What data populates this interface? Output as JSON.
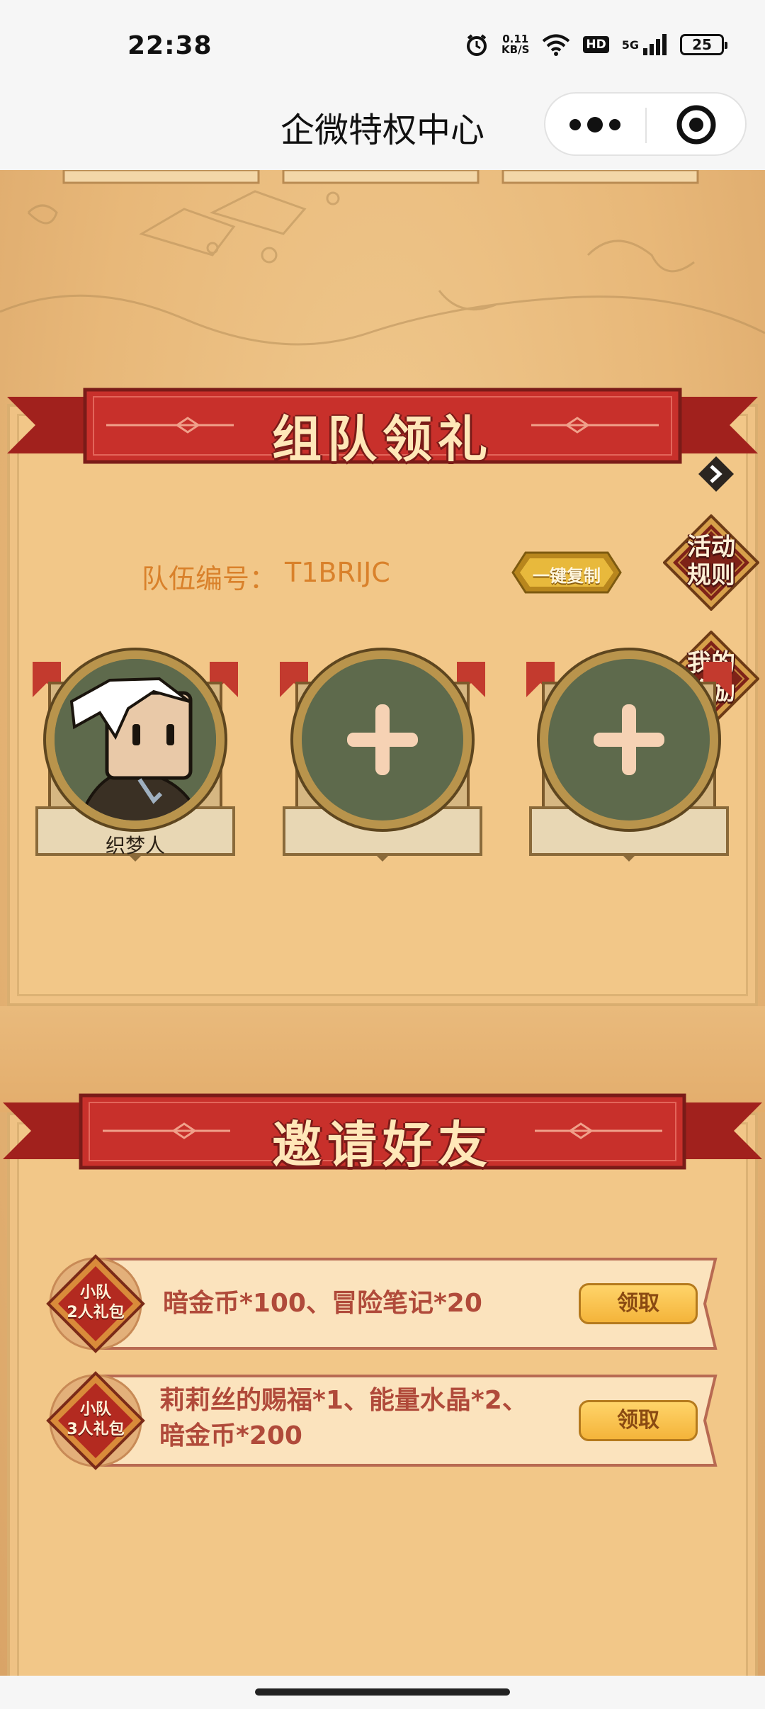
{
  "status_bar": {
    "time": "22:38",
    "net_speed_value": "0.11",
    "net_speed_unit": "KB/S",
    "hd_label": "HD",
    "network_label": "5G",
    "battery_level": "25",
    "icons": [
      "alarm-icon",
      "wifi-icon",
      "signal-icon",
      "battery-icon"
    ]
  },
  "title_bar": {
    "title": "企微特权中心",
    "icons": [
      "more-icon",
      "close-miniprogram-icon"
    ]
  },
  "team_section": {
    "heading": "组队领礼",
    "team_number_label": "队伍编号：",
    "team_number": "T1BRIJC",
    "copy_button": "一键复制",
    "rules_button_line1": "活动",
    "rules_button_line2": "规则",
    "rewards_button_line1": "我的",
    "rewards_button_line2": "奖励",
    "members": [
      {
        "name": "织梦人",
        "filled": true
      },
      {
        "name": "",
        "filled": false
      },
      {
        "name": "",
        "filled": false
      }
    ]
  },
  "invite_section": {
    "heading": "邀请好友",
    "rewards": [
      {
        "badge_line1": "小队",
        "badge_line2": "2人礼包",
        "text_line1": "暗金币*100、冒险笔记*20",
        "text_line2": "",
        "button": "领取"
      },
      {
        "badge_line1": "小队",
        "badge_line2": "3人礼包",
        "text_line1": "莉莉丝的赐福*1、能量水晶*2、",
        "text_line2": "暗金币*200",
        "button": "领取"
      }
    ]
  },
  "colors": {
    "ribbon_red": "#c8302b",
    "panel": "#f2c788",
    "accent_orange": "#d9812b",
    "slot_green": "#5e6a4c",
    "claim_gold": "#f4b43a"
  }
}
